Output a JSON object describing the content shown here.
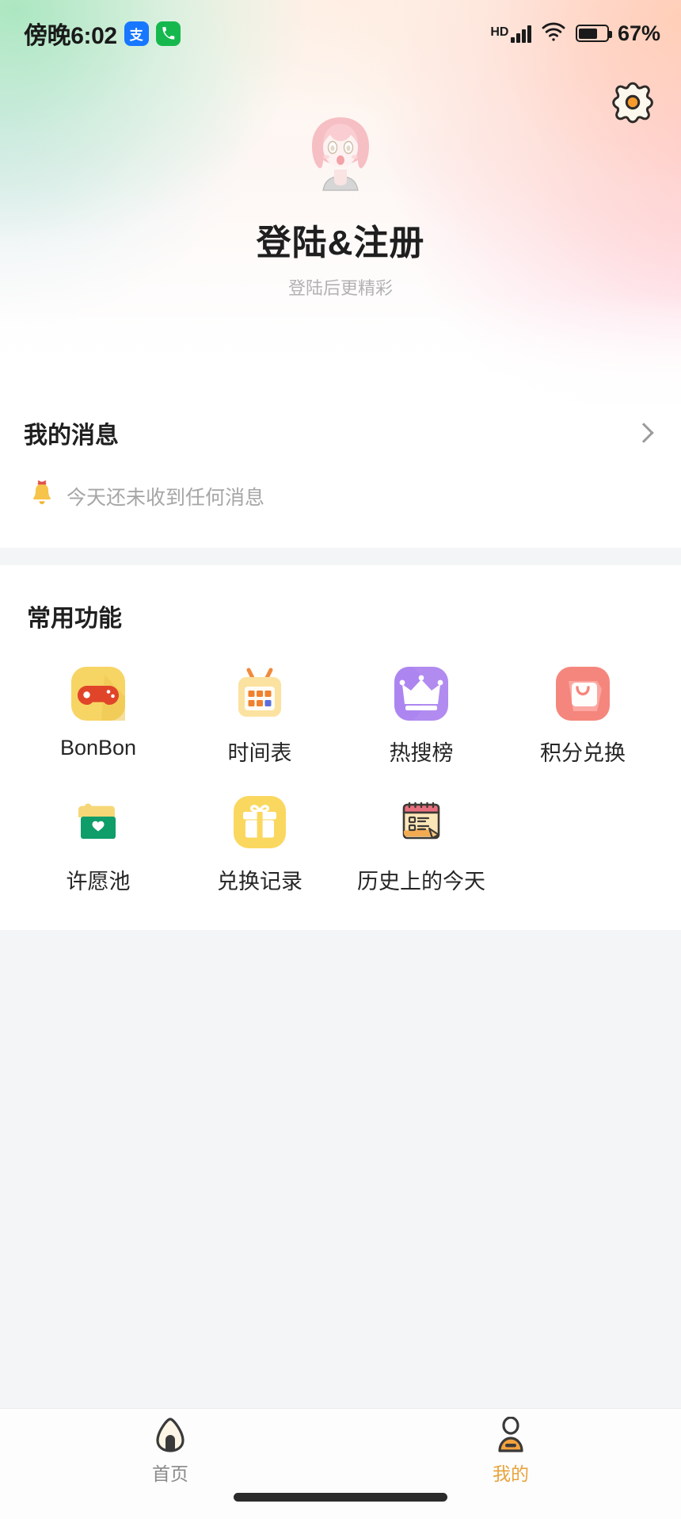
{
  "status_bar": {
    "time": "傍晚6:02",
    "alipay_badge": "支",
    "phone_badge": "✆",
    "hd_label": "HD",
    "battery_percent": "67%",
    "battery_level": 67,
    "icons": [
      "alipay-icon",
      "phone-icon",
      "hd-icon",
      "signal-icon",
      "wifi-icon",
      "battery-icon"
    ]
  },
  "header": {
    "settings_icon": "gear-icon",
    "avatar_icon": "user-avatar",
    "login_title": "登陆&注册",
    "login_subtitle": "登陆后更精彩"
  },
  "messages": {
    "title": "我的消息",
    "chevron_icon": "chevron-right-icon",
    "empty_icon": "bell-icon",
    "empty_text": "今天还未收到任何消息"
  },
  "functions": {
    "title": "常用功能",
    "items": [
      {
        "label": "BonBon",
        "icon": "gamepad-icon",
        "bg": "#f7d565",
        "fg": "#e0452a"
      },
      {
        "label": "时间表",
        "icon": "calendar-icon",
        "bg": "#fbe2a0",
        "fg": "#f08a3c"
      },
      {
        "label": "热搜榜",
        "icon": "crown-icon",
        "bg": "#b18bf0",
        "fg": "#ffffff"
      },
      {
        "label": "积分兑换",
        "icon": "shopping-bag-icon",
        "bg": "#f5867d",
        "fg": "#ffffff"
      },
      {
        "label": "许愿池",
        "icon": "wish-box-icon",
        "bg": "#0f9d6a",
        "fg": "#ffffff"
      },
      {
        "label": "兑换记录",
        "icon": "gift-icon",
        "bg": "#fad75f",
        "fg": "#ffffff"
      },
      {
        "label": "历史上的今天",
        "icon": "history-note-icon",
        "bg": "#f6dfae",
        "fg": "#e8707f"
      }
    ]
  },
  "tabbar": {
    "items": [
      {
        "label": "首页",
        "icon": "onigiri-home-icon",
        "active": false
      },
      {
        "label": "我的",
        "icon": "person-icon",
        "active": true
      }
    ],
    "active_color": "#e8a33d",
    "inactive_color": "#8a8a8a"
  }
}
